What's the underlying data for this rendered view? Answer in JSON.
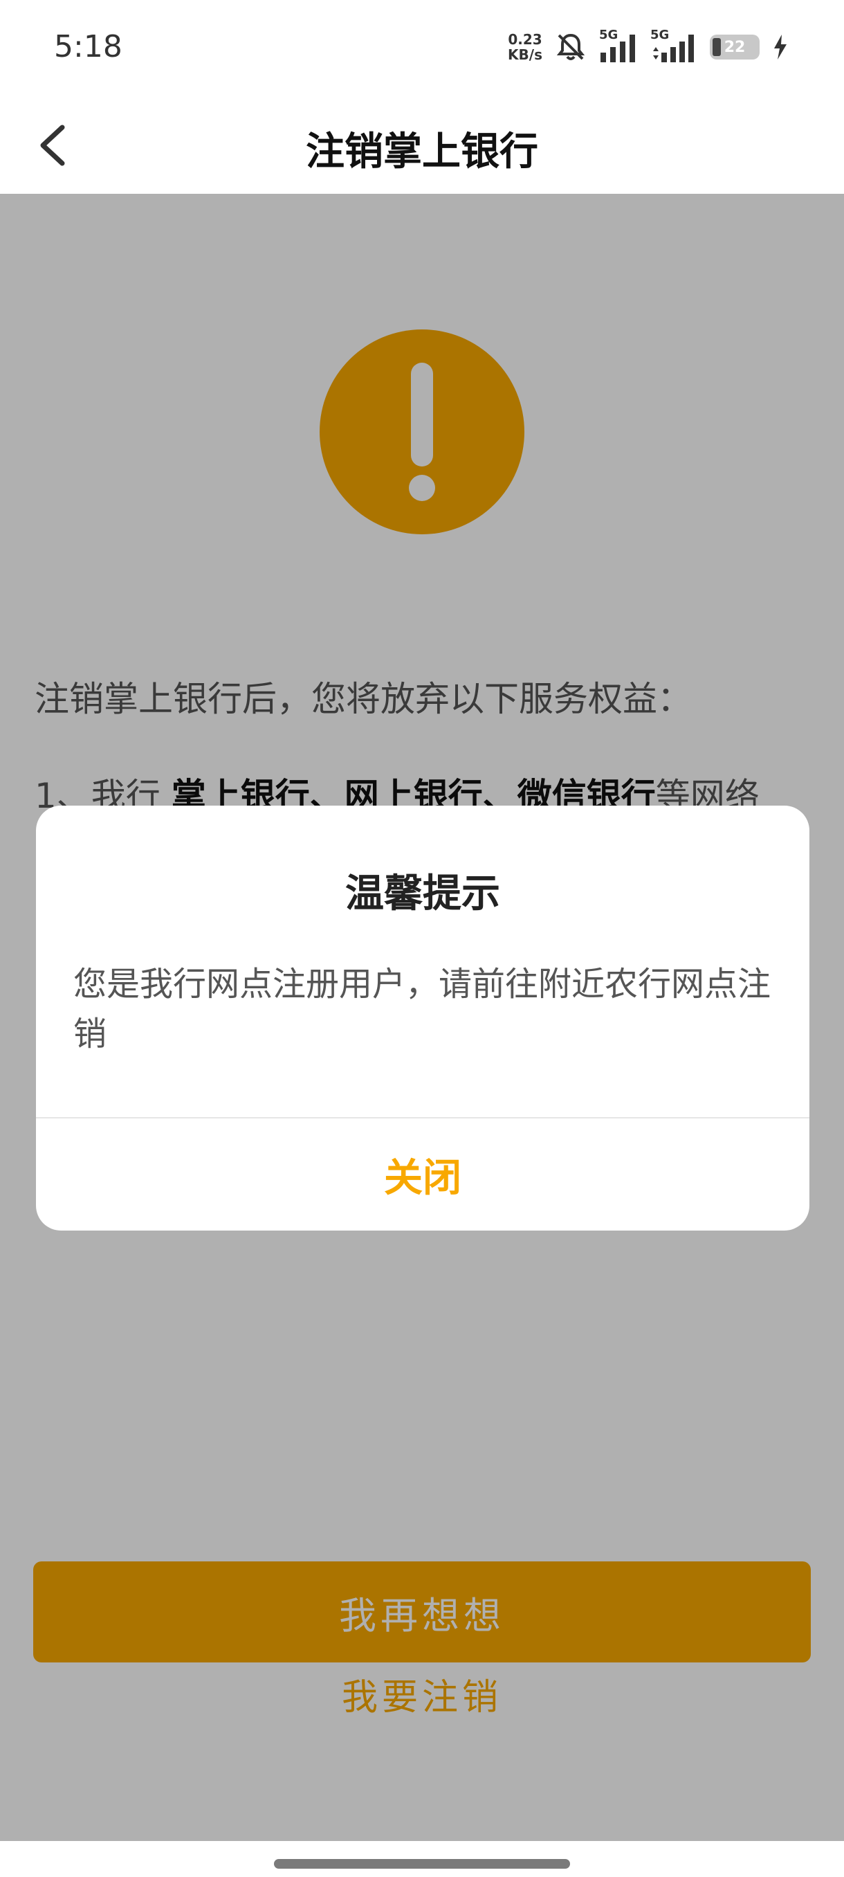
{
  "status_bar": {
    "time": "5:18",
    "net_speed_value": "0.23",
    "net_speed_unit": "KB/s",
    "signal1_label": "5G",
    "signal2_label": "5G",
    "battery_level": "22"
  },
  "header": {
    "title": "注销掌上银行"
  },
  "content": {
    "intro": "注销掌上银行后，您将放弃以下服务权益：",
    "rule_prefix": "1、我行 ",
    "rule_strong": "掌上银行、网上银行、微信银行",
    "rule_suffix": "等网络"
  },
  "dialog": {
    "title": "温馨提示",
    "message": "您是我行网点注册用户，请前往附近农行网点注销",
    "close_label": "关闭"
  },
  "actions": {
    "primary_label": "我再想想",
    "secondary_label": "我要注销"
  },
  "colors": {
    "accent": "#f8a800",
    "overlay": "rgba(0,0,0,0.31)"
  }
}
